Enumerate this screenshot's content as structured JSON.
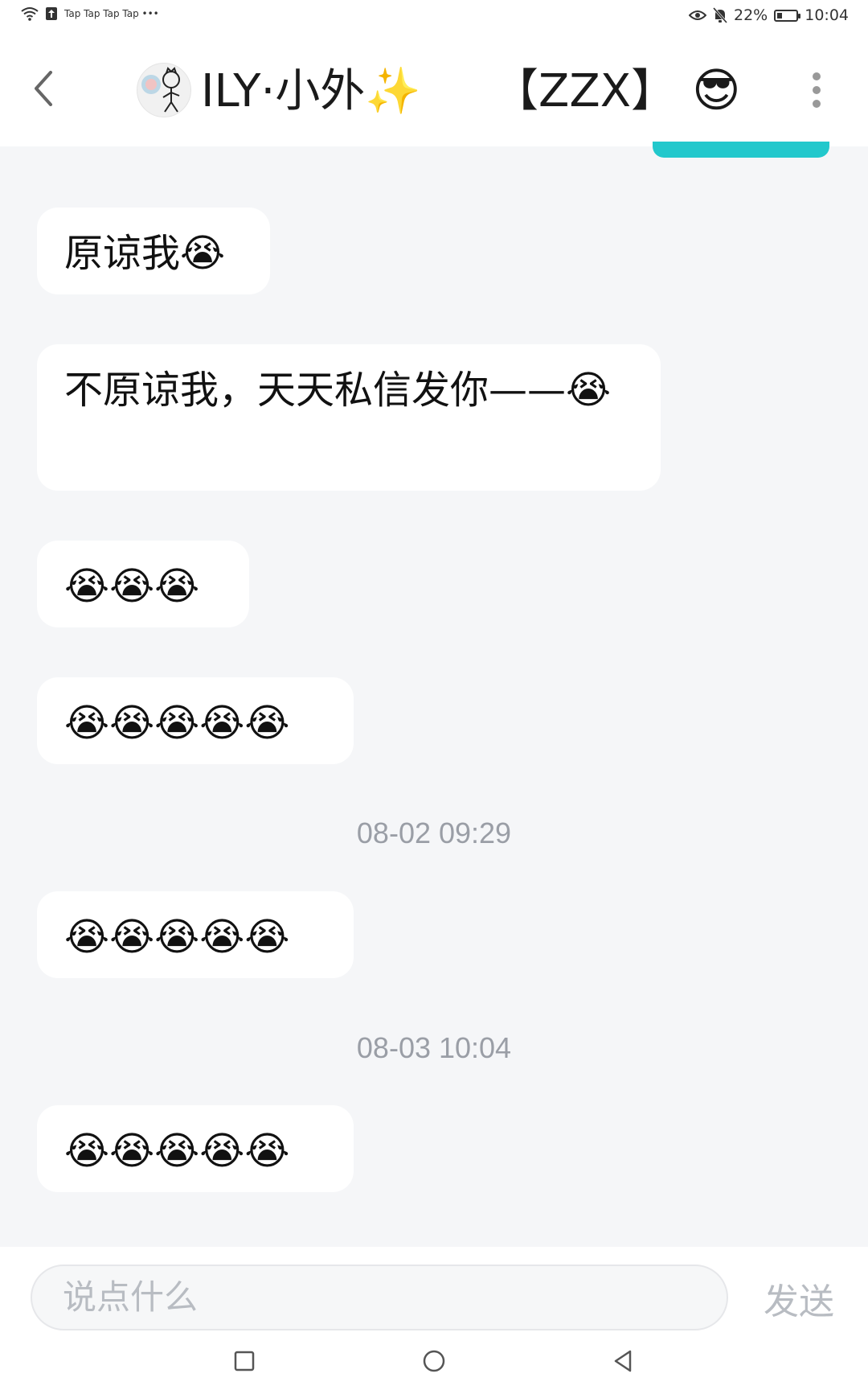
{
  "status_bar": {
    "left_text": "Tap Tap Tap Tap •••",
    "battery": "22%",
    "time": "10:04"
  },
  "header": {
    "title_name": "ILY·小外✨",
    "title_tag": "【ZZX】",
    "title_emoji": "😎"
  },
  "messages": [
    {
      "text": "原谅我😭"
    },
    {
      "text": "不原谅我，天天私信发你——😭"
    },
    {
      "text": "😭😭😭"
    },
    {
      "text": "😭😭😭😭😭"
    },
    {
      "text": "😭😭😭😭😭"
    },
    {
      "text": "😭😭😭😭😭"
    }
  ],
  "timestamps": [
    "08-02 09:29",
    "08-03 10:04"
  ],
  "input": {
    "placeholder": "说点什么",
    "send_label": "发送"
  },
  "colors": {
    "accent": "#22c8cc",
    "background": "#f5f6f8",
    "bubble": "#ffffff"
  }
}
